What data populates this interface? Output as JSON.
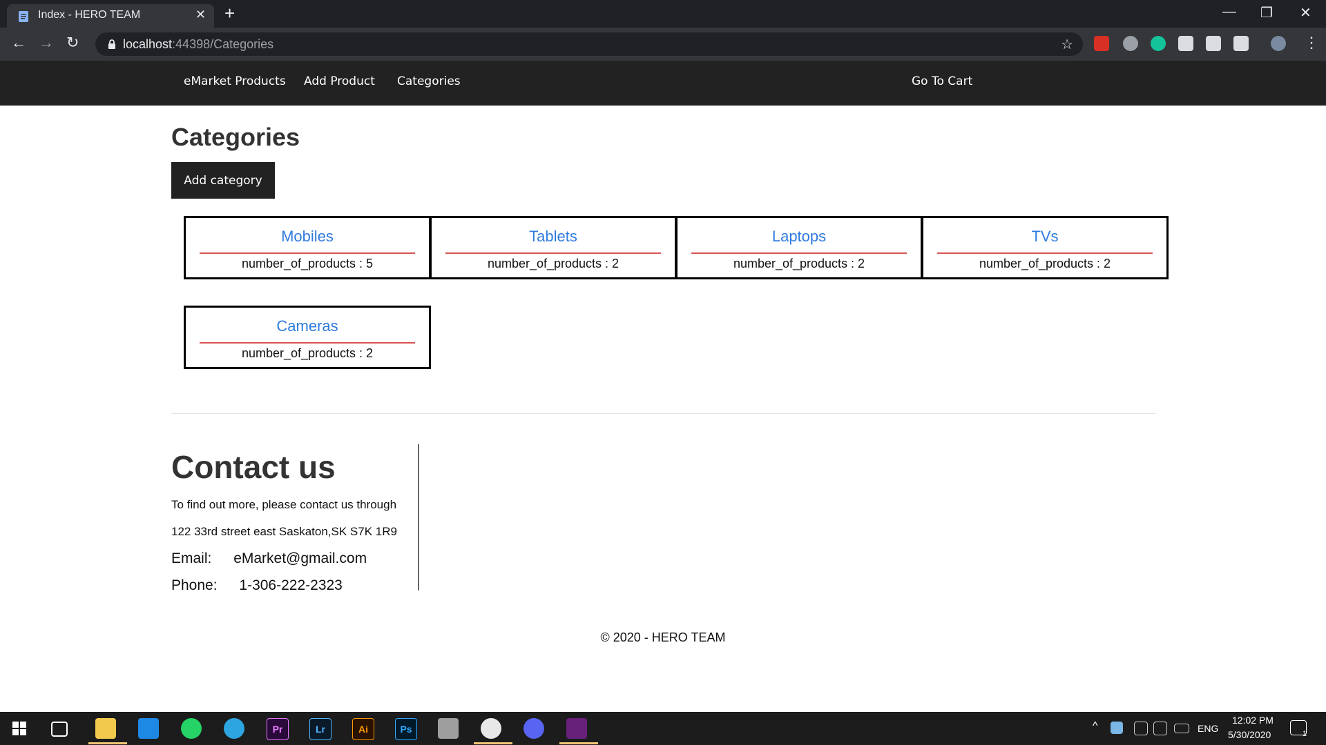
{
  "browser": {
    "tab_title": "Index - HERO TEAM",
    "new_tab_glyph": "+",
    "close_glyph": "✕",
    "url_host": "localhost",
    "url_rest": ":44398/Categories",
    "back_glyph": "←",
    "forward_glyph": "→",
    "reload_glyph": "↻",
    "star_glyph": "☆",
    "menu_glyph": "⋮",
    "minimize_glyph": "—",
    "restore_glyph": "❐",
    "window_close_glyph": "✕"
  },
  "nav": {
    "products": "eMarket Products",
    "add_product": "Add Product",
    "categories": "Categories",
    "cart": "Go To Cart"
  },
  "main": {
    "title": "Categories",
    "add_category": "Add category",
    "categories": [
      {
        "name": "Mobiles",
        "count_text": "number_of_products : 5"
      },
      {
        "name": "Tablets",
        "count_text": "number_of_products : 2"
      },
      {
        "name": "Laptops",
        "count_text": "number_of_products : 2"
      },
      {
        "name": "TVs",
        "count_text": "number_of_products : 2"
      },
      {
        "name": "Cameras",
        "count_text": "number_of_products : 2"
      }
    ]
  },
  "contact": {
    "title": "Contact us",
    "intro": "To find out more, please contact us through",
    "address": "122 33rd street east Saskaton,SK S7K 1R9",
    "email_label": "Email:",
    "email": "eMarket@gmail.com",
    "phone_label": "Phone:",
    "phone": "1-306-222-2323"
  },
  "footer": {
    "copyright": "© 2020 - HERO TEAM"
  },
  "taskbar": {
    "apps": [
      "Pr",
      "Lr",
      "Ai",
      "Ps"
    ],
    "language": "ENG",
    "time": "12:02 PM",
    "date": "5/30/2020",
    "notification_count": "1"
  }
}
